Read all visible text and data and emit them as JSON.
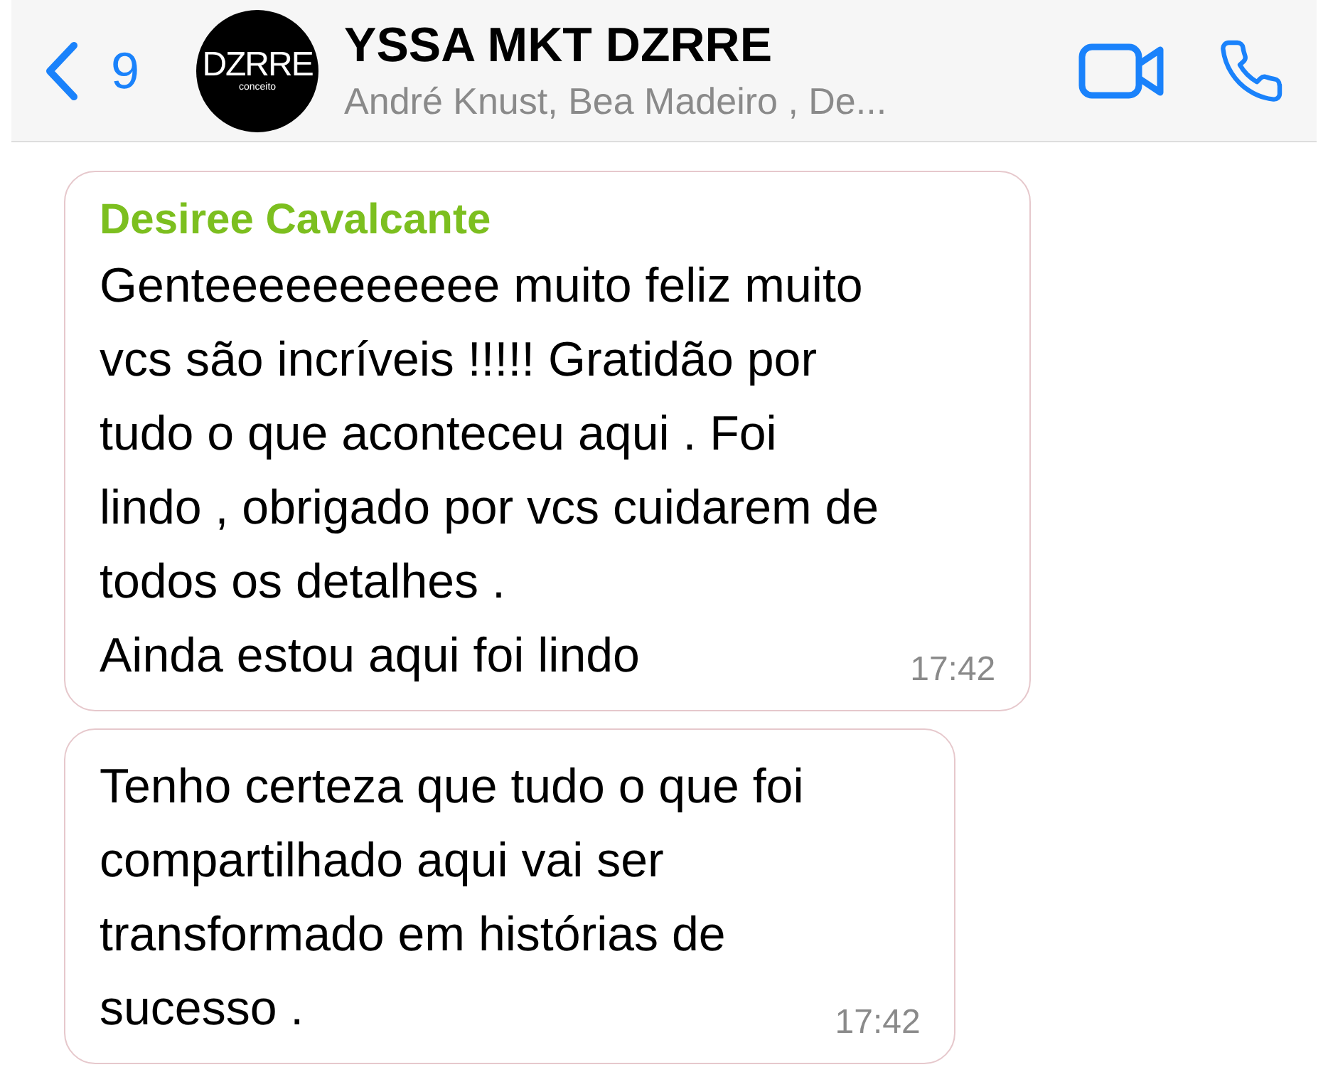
{
  "header": {
    "back_count": "9",
    "avatar": {
      "logo": "DZRRE",
      "tagline": "conceito"
    },
    "title": "YSSA MKT DZRRE",
    "members": "André Knust, Bea Madeiro , De..."
  },
  "messages": [
    {
      "sender": "Desiree Cavalcante",
      "color": "#7cbf1f",
      "lines": [
        "Genteeeeeeeeeee muito feliz muito",
        "vcs são incríveis !!!!! Gratidão por",
        "tudo o que aconteceu aqui . Foi",
        "lindo , obrigado por vcs cuidarem de",
        "todos os detalhes .",
        "Ainda estou aqui foi lindo"
      ],
      "time": "17:42"
    },
    {
      "lines": [
        "Tenho certeza que tudo o que foi",
        "compartilhado aqui vai ser",
        "transformado em histórias de",
        "sucesso ."
      ],
      "time": "17:42"
    }
  ]
}
